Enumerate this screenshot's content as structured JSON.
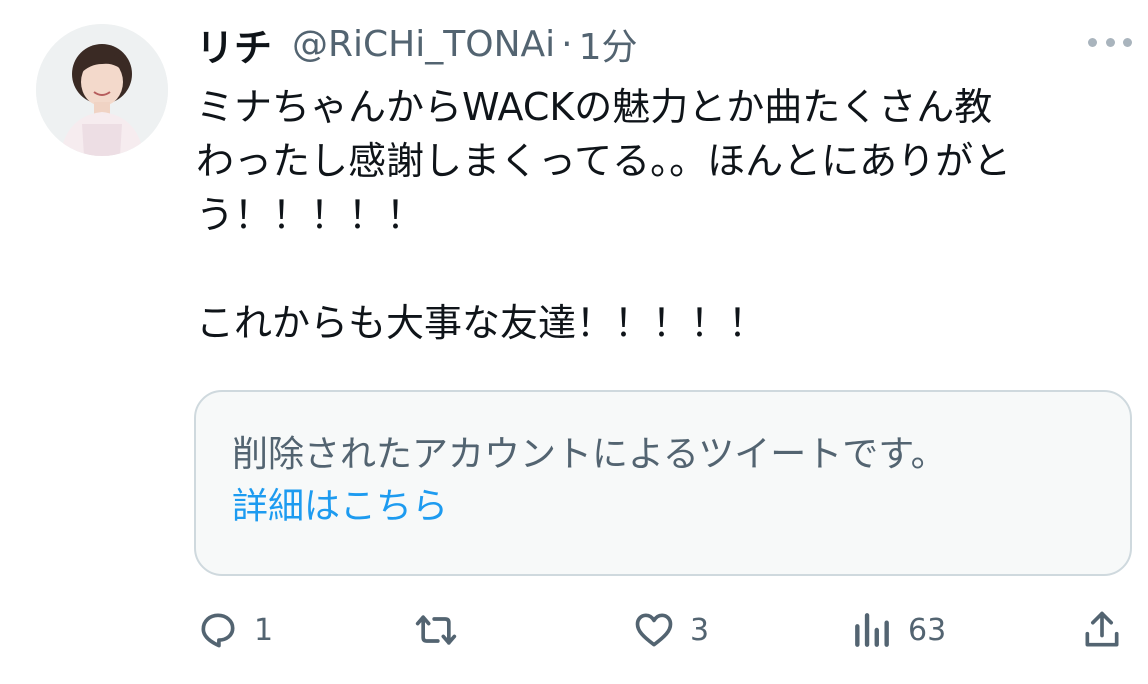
{
  "tweet": {
    "author_name": "リチ",
    "handle": "@RiCHi_TONAi",
    "separator": "·",
    "time": "1分",
    "text_lines": [
      "ミナちゃんからWACKの魅力とか曲たくさん教",
      "わったし感謝しまくってる。。ほんとにありがと",
      "う！！！！！",
      "",
      "これからも大事な友達！！！！！"
    ]
  },
  "quote": {
    "message": "削除されたアカウントによるツイートです。",
    "link_label": "詳細はこちら"
  },
  "actions": {
    "reply_count": "1",
    "retweet_count": "",
    "like_count": "3",
    "views_count": "63"
  },
  "icons": {
    "more": "more-dots-icon",
    "reply": "reply-icon",
    "retweet": "retweet-icon",
    "like": "heart-icon",
    "views": "views-chart-icon",
    "share": "share-icon"
  },
  "colors": {
    "text": "#0f1419",
    "secondary": "#536471",
    "link": "#1d9bf0",
    "border": "#cfd9de",
    "card_bg": "#f7f9f9"
  }
}
